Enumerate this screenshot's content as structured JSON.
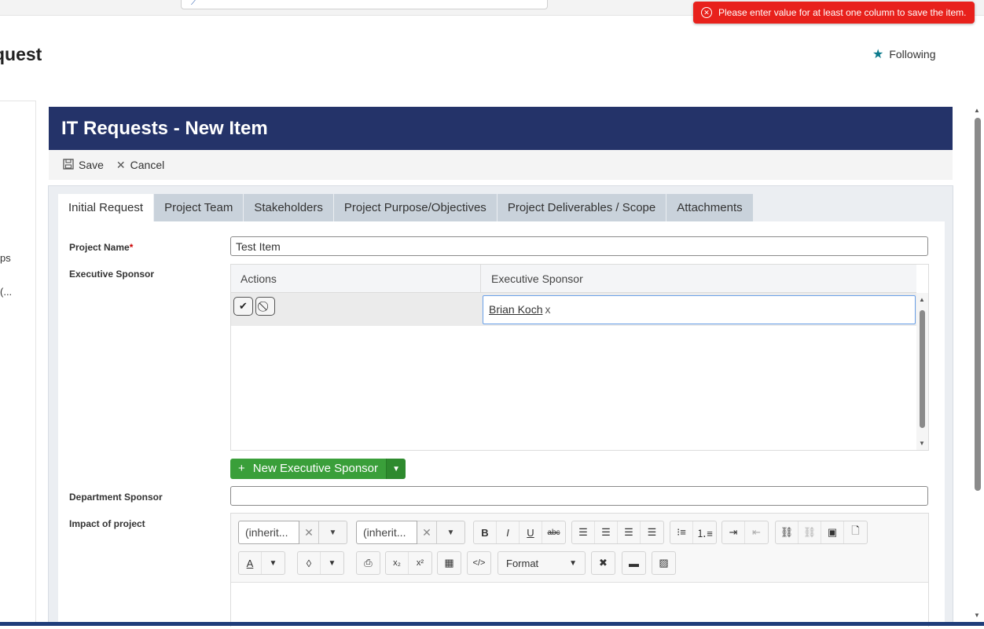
{
  "page": {
    "title": "quest",
    "following_label": "Following"
  },
  "toast": {
    "message": "Please enter value for at least one column to save the item."
  },
  "leftnav": {
    "item1": "ps",
    "item2": "(..."
  },
  "form": {
    "header": "IT Requests - New Item",
    "commands": {
      "save": "Save",
      "cancel": "Cancel"
    },
    "tabs": [
      "Initial Request",
      "Project Team",
      "Stakeholders",
      "Project Purpose/Objectives",
      "Project Deliverables / Scope",
      "Attachments"
    ],
    "active_tab": "Initial Request",
    "fields": {
      "project_name": {
        "label": "Project Name",
        "required_mark": "*",
        "value": "Test Item"
      },
      "executive_sponsor": {
        "label": "Executive Sponsor"
      },
      "department_sponsor": {
        "label": "Department Sponsor",
        "value": ""
      },
      "impact": {
        "label": "Impact of project"
      }
    },
    "grid": {
      "columns": [
        "Actions",
        "Executive Sponsor"
      ],
      "rows": [
        {
          "person": "Brian Koch",
          "remove": "x"
        }
      ],
      "new_button": "New Executive Sponsor"
    },
    "editor": {
      "font_family": "(inherit...",
      "font_size": "(inherit...",
      "format_label": "Format"
    }
  },
  "colors": {
    "header_bg": "#243369",
    "toast_bg": "#e8211c",
    "new_button_bg": "#3a9f3a",
    "tab_inactive": "#c9d2db"
  }
}
